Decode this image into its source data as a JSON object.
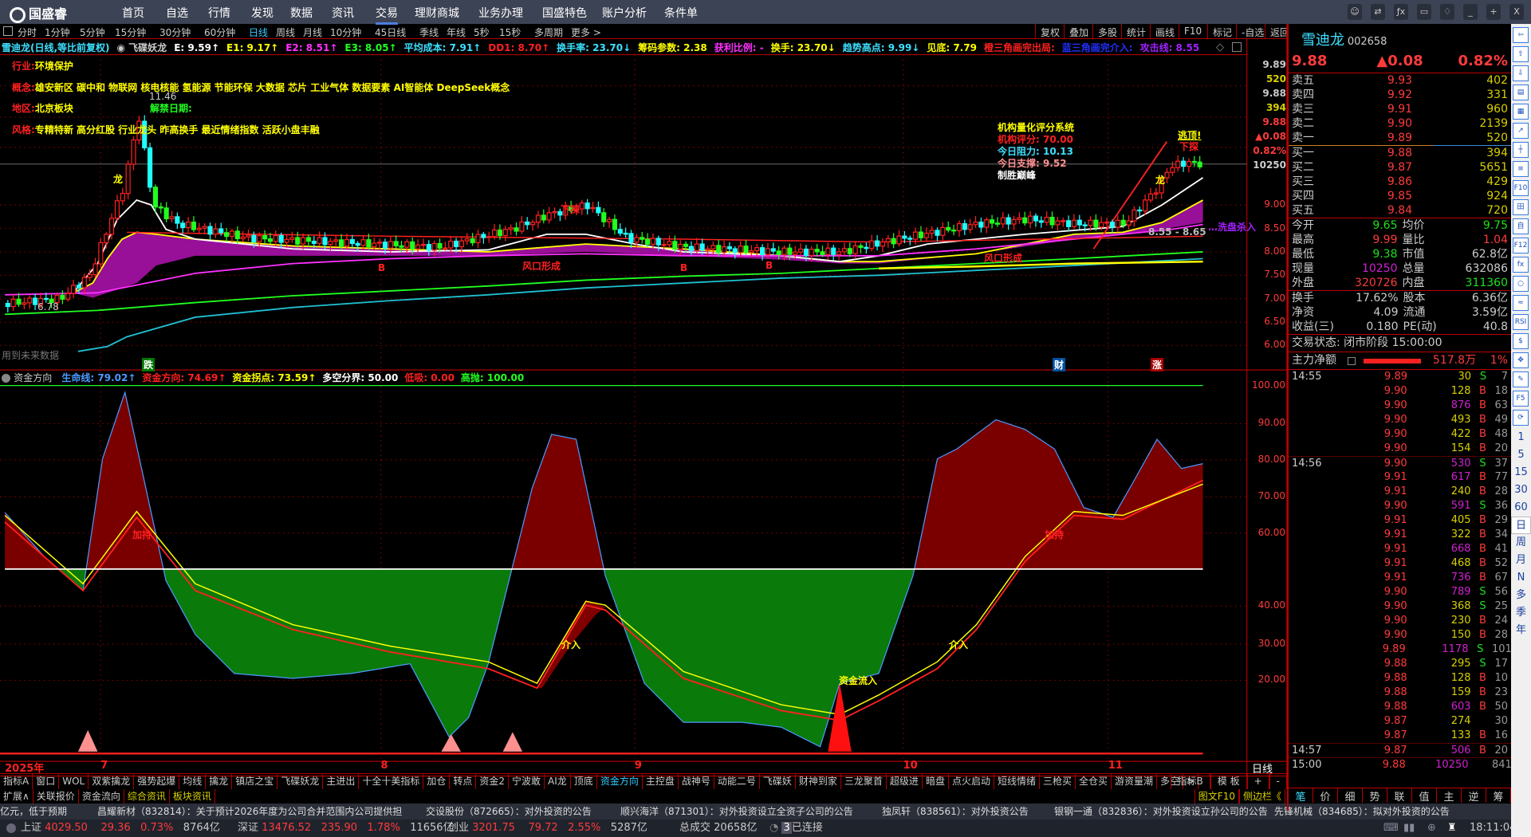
{
  "app": {
    "logo": "国盛睿",
    "menu": [
      "首页",
      "自选",
      "行情",
      "发现",
      "数据",
      "资讯",
      "交易",
      "理财商城",
      "业务办理",
      "国盛特色",
      "账户分析",
      "条件单"
    ],
    "active_menu": "交易",
    "window_buttons": [
      "客服",
      "切换",
      "公式",
      "屏幕",
      "皮肤",
      "最小化",
      "最大化",
      "关闭"
    ]
  },
  "periods": [
    "分时",
    "1分钟",
    "5分钟",
    "15分钟",
    "30分钟",
    "60分钟",
    "日线",
    "周线",
    "月线",
    "10分钟",
    "45日线",
    "季线",
    "年线",
    "5秒",
    "15秒",
    "多周期",
    "更多 >"
  ],
  "active_period": "日线",
  "tools": [
    "复权",
    "叠加",
    "多股",
    "统计",
    "画线",
    "F10",
    "标记",
    "-自选",
    "返回"
  ],
  "info_line": [
    {
      "t": "雪迪龙(日线,等比前复权)",
      "c": "#3de0ff"
    },
    {
      "t": "◉ 飞碟妖龙",
      "c": "#ccc"
    },
    {
      "t": "E: 9.59↑",
      "c": "#fff"
    },
    {
      "t": "E1: 9.17↑",
      "c": "#ffff00"
    },
    {
      "t": "E2: 8.51↑",
      "c": "#ff30ff"
    },
    {
      "t": "E3: 8.05↑",
      "c": "#20ff20"
    },
    {
      "t": "平均成本: 7.91↑",
      "c": "#3de0ff"
    },
    {
      "t": "DD1: 8.70↑",
      "c": "#ff2020"
    },
    {
      "t": "换手率: 23.70↓",
      "c": "#3de0ff"
    },
    {
      "t": "筹码参数: 2.38",
      "c": "#ffff00"
    },
    {
      "t": "获利比例: -",
      "c": "#ff30ff"
    },
    {
      "t": "换手: 23.70↓",
      "c": "#ffff00"
    },
    {
      "t": "趋势高点: 9.99↓",
      "c": "#3de0ff"
    },
    {
      "t": "见底: 7.79",
      "c": "#ffff00"
    },
    {
      "t": "橙三角画完出局:",
      "c": "#ff2020"
    },
    {
      "t": "蓝三角画完介入:",
      "c": "#2030ff"
    },
    {
      "t": "攻击线: 8.55",
      "c": "#a020ff"
    }
  ],
  "overlay": {
    "industry_label": "行业:",
    "industry": "环境保护",
    "concept_label": "概念:",
    "concept": "雄安新区 碳中和 物联网 核电核能 氢能源 节能环保 大数据 芯片 工业气体 数据要素 AI智能体 DeepSeek概念",
    "region_label": "地区:",
    "region": "北京板块",
    "unlock": "解禁日期:",
    "style_label": "风格:",
    "style": "专精特新 高分红股 行业龙头 昨高换手 最近情绪指数 活跃小盘丰融",
    "high_price": "11.46",
    "low_price": "6.78",
    "score_title": "机构量化评分系统",
    "score_label": "机构评分:",
    "score": "70.00",
    "resist_label": "今日阻力:",
    "resist": "10.13",
    "support_label": "今日支撑:",
    "support": "9.52",
    "slogan": "制胜巅峰",
    "escape": "逃顶!",
    "probe": "下探",
    "probe2": "下探",
    "dragon": "龙",
    "wind": "风口形成",
    "wind2": "风口形成",
    "b": "B",
    "wash": "…洗盘杀入",
    "attack_range": "8.55 - 8.65",
    "future": "用到未来数据",
    "mark_die": "跌",
    "mark_cai": "财",
    "mark_zhang": "涨"
  },
  "price_axis": {
    "float_box": [
      "9.89",
      "520",
      "9.88",
      "394",
      "9.88",
      "▲0.08",
      "0.82%",
      "10250"
    ],
    "ticks": [
      "9.00",
      "8.50",
      "8.00",
      "7.50",
      "7.00",
      "6.50",
      "6.00"
    ]
  },
  "lower": {
    "title": "资金方向",
    "items": [
      {
        "t": "生命线: 79.02↑",
        "c": "#4a9aff"
      },
      {
        "t": "资金方向: 74.69↑",
        "c": "#ff2020"
      },
      {
        "t": "资金拐点: 73.59↑",
        "c": "#ffff00"
      },
      {
        "t": "多空分界: 50.00",
        "c": "#fff"
      },
      {
        "t": "低吸: 0.00",
        "c": "#ff2020"
      },
      {
        "t": "高抛: 100.00",
        "c": "#20ff20"
      }
    ],
    "ticks": [
      "100.00",
      "90.00",
      "80.00",
      "70.00",
      "60.00",
      "40.00",
      "30.00",
      "20.00"
    ],
    "labels": {
      "jiachi": "加持",
      "jieru": "介入",
      "inflow": "资金流入"
    }
  },
  "date_axis": [
    "2025年",
    "7",
    "8",
    "9",
    "10",
    "11"
  ],
  "date_mode": "日线",
  "indicator_tabs": [
    "指标A",
    "窗口",
    "WOL",
    "双紫擒龙",
    "强势起爆",
    "均线",
    "擒龙",
    "镇店之宝",
    "飞碟妖龙",
    "主进出",
    "十全十美指标",
    "加仓",
    "转点",
    "资金2",
    "宁波敢",
    "AI龙",
    "顶底",
    "资金方向",
    "主控盘",
    "战神号",
    "动能二号",
    "飞碟妖",
    "财神到家",
    "三龙聚首",
    "超级进",
    "暗盘",
    "点火启动",
    "短线情绪",
    "三枪买",
    "全仓买",
    "游资量潮",
    "多空",
    ">"
  ],
  "active_indicator": "资金方向",
  "indicator_right": [
    "指标B",
    "模 板",
    "+",
    "-"
  ],
  "ext_tabs": [
    "扩展∧",
    "关联报价",
    "资金流向",
    "综合资讯",
    "板块资讯"
  ],
  "ext_right": [
    "图文F10",
    "侧边栏《"
  ],
  "news": [
    "亿元，低于预期",
    "昌耀新材（832814）：关于预计2026年度为公司合并范围内公司提供担",
    "交设股份（872665）：对外投资的公告",
    "顺兴海洋（871301）：对外投资设立全资子公司的公告",
    "独凤轩（838561）：对外投资公告",
    "银钢一通（832836）：对外投资设立孙公司的公告",
    "先锋机械（834685）：拟对外投资的公告"
  ],
  "status": {
    "sh_label": "上证",
    "sh": "4029.50",
    "sh_chg": "29.36",
    "sh_pct": "0.73%",
    "sh_amt": "8764亿",
    "sz_label": "深证",
    "sz": "13476.52",
    "sz_chg": "235.90",
    "sz_pct": "1.78%",
    "sz_amt": "11656亿",
    "cy_label": "创业",
    "cy": "3201.75",
    "cy_chg": "79.72",
    "cy_pct": "2.55%",
    "cy_amt": "5287亿",
    "total_label": "总成交",
    "total": "20658亿",
    "conn": "已连接",
    "conn_num": "3",
    "time": "18:11:04"
  },
  "quote": {
    "name": "雪迪龙",
    "code": "002658",
    "price": "9.88",
    "change": "▲0.08",
    "pct": "0.82%",
    "asks": [
      {
        "l": "卖五",
        "p": "9.93",
        "v": "402"
      },
      {
        "l": "卖四",
        "p": "9.92",
        "v": "331"
      },
      {
        "l": "卖三",
        "p": "9.91",
        "v": "960"
      },
      {
        "l": "卖二",
        "p": "9.90",
        "v": "2139"
      },
      {
        "l": "卖一",
        "p": "9.89",
        "v": "520"
      }
    ],
    "bids": [
      {
        "l": "买一",
        "p": "9.88",
        "v": "394"
      },
      {
        "l": "买二",
        "p": "9.87",
        "v": "5651"
      },
      {
        "l": "买三",
        "p": "9.86",
        "v": "429"
      },
      {
        "l": "买四",
        "p": "9.85",
        "v": "924"
      },
      {
        "l": "买五",
        "p": "9.84",
        "v": "720"
      }
    ],
    "stats": [
      [
        "今开",
        "9.65",
        "g",
        "均价",
        "9.75",
        "g"
      ],
      [
        "最高",
        "9.99",
        "r",
        "量比",
        "1.04",
        "r"
      ],
      [
        "最低",
        "9.38",
        "g",
        "市值",
        "62.8亿",
        "w"
      ],
      [
        "现量",
        "10250",
        "m",
        "总量",
        "632086",
        "w"
      ],
      [
        "外盘",
        "320726",
        "r",
        "内盘",
        "311360",
        "g"
      ]
    ],
    "stats2": [
      [
        "换手",
        "17.62%",
        "股本",
        "6.36亿"
      ],
      [
        "净资",
        "4.09",
        "流通",
        "3.59亿"
      ],
      [
        "收益(三)",
        "0.180",
        "PE(动)",
        "40.8"
      ]
    ],
    "trade_state": "交易状态: 闭市阶段 15:00:00",
    "main_net_label": "主力净额",
    "main_net": "517.8万",
    "main_net_pct": "1%",
    "ticks": [
      [
        "14:55",
        "9.89",
        "30",
        "S",
        "7"
      ],
      [
        "",
        "9.90",
        "128",
        "B",
        "18"
      ],
      [
        "",
        "9.90",
        "876",
        "B",
        "63"
      ],
      [
        "",
        "9.90",
        "493",
        "B",
        "49"
      ],
      [
        "",
        "9.90",
        "422",
        "B",
        "48"
      ],
      [
        "",
        "9.90",
        "154",
        "B",
        "20"
      ],
      [
        "14:56",
        "9.90",
        "530",
        "S",
        "37"
      ],
      [
        "",
        "9.91",
        "617",
        "B",
        "77"
      ],
      [
        "",
        "9.91",
        "240",
        "B",
        "28"
      ],
      [
        "",
        "9.90",
        "591",
        "S",
        "36"
      ],
      [
        "",
        "9.91",
        "405",
        "B",
        "29"
      ],
      [
        "",
        "9.91",
        "322",
        "B",
        "34"
      ],
      [
        "",
        "9.91",
        "668",
        "B",
        "41"
      ],
      [
        "",
        "9.91",
        "468",
        "B",
        "52"
      ],
      [
        "",
        "9.91",
        "736",
        "B",
        "67"
      ],
      [
        "",
        "9.90",
        "789",
        "S",
        "56"
      ],
      [
        "",
        "9.90",
        "368",
        "S",
        "25"
      ],
      [
        "",
        "9.90",
        "230",
        "B",
        "24"
      ],
      [
        "",
        "9.90",
        "150",
        "B",
        "28"
      ],
      [
        "",
        "9.89",
        "1178",
        "S",
        "101"
      ],
      [
        "",
        "9.88",
        "295",
        "S",
        "17"
      ],
      [
        "",
        "9.88",
        "128",
        "B",
        "10"
      ],
      [
        "",
        "9.88",
        "159",
        "B",
        "23"
      ],
      [
        "",
        "9.88",
        "603",
        "B",
        "50"
      ],
      [
        "",
        "9.87",
        "274",
        "",
        "30"
      ],
      [
        "",
        "9.87",
        "133",
        "B",
        "16"
      ],
      [
        "14:57",
        "9.87",
        "506",
        "B",
        "20"
      ],
      [
        "15:00",
        "9.88",
        "10250",
        "",
        "841"
      ]
    ],
    "bottom_tabs": [
      "笔",
      "价",
      "细",
      "势",
      "联",
      "值",
      "主",
      "逆",
      "筹"
    ]
  },
  "side_periods": [
    "1",
    "5",
    "15",
    "30",
    "60",
    "日",
    "周",
    "月",
    "N",
    "多",
    "季",
    "年"
  ]
}
